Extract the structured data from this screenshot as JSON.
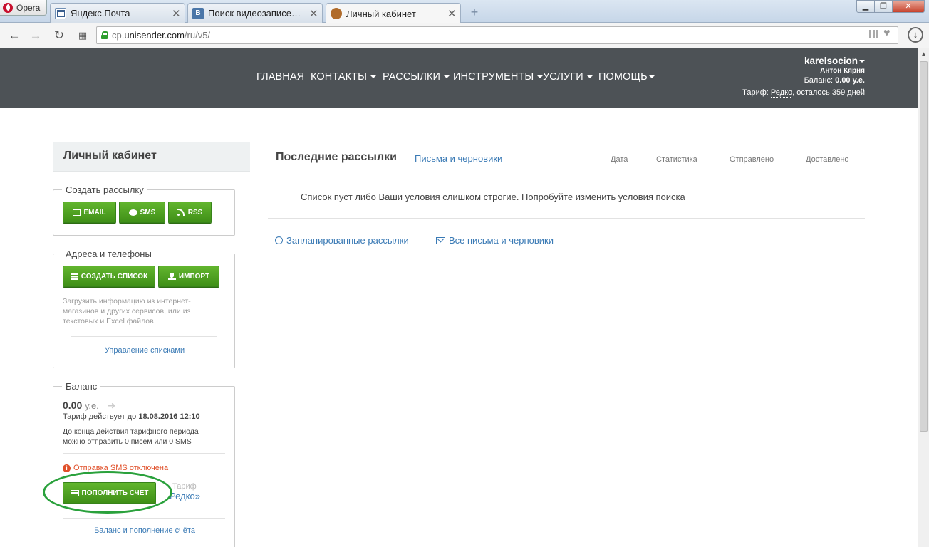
{
  "browser": {
    "opera_label": "Opera",
    "tabs": [
      {
        "title": "Яндекс.Почта",
        "active": false
      },
      {
        "title": "Поиск видеозаписей по sk",
        "active": false
      },
      {
        "title": "Личный кабинет",
        "active": true
      }
    ],
    "address": {
      "domain_prefix": "cp.",
      "domain": "unisender.com",
      "path": "/ru/v5/"
    }
  },
  "header": {
    "menu": [
      {
        "label": "Главная",
        "dropdown": false
      },
      {
        "label": "Контакты",
        "dropdown": true
      },
      {
        "label": "Рассылки",
        "dropdown": true
      },
      {
        "label": "Инструменты",
        "dropdown": true
      },
      {
        "label": "Услуги",
        "dropdown": true
      },
      {
        "label": "Помощь",
        "dropdown": true
      }
    ],
    "user": {
      "login": "karelsocion",
      "name": "Антон Кярня",
      "balance_label": "Баланс:",
      "balance_value": "0.00 у.е.",
      "tariff_label": "Тариф:",
      "tariff_value": "Редко",
      "tariff_suffix": ", осталось 359 дней"
    }
  },
  "sidebar": {
    "title": "Личный кабинет",
    "create": {
      "legend": "Создать рассылку",
      "buttons": [
        "EMAIL",
        "SMS",
        "RSS"
      ]
    },
    "contacts": {
      "legend": "Адреса и телефоны",
      "create_list": "Создать список",
      "import": "Импорт",
      "hint": "Загрузить информацию из интернет-магазинов и других сервисов, или из текстовых и Excel файлов",
      "manage_link": "Управление списками"
    },
    "balance": {
      "legend": "Баланс",
      "amount": "0.00",
      "unit": "у.е.",
      "tariff_until_label": "Тариф действует до",
      "tariff_until": "18.08.2016 12:10",
      "period_text": "До конца действия тарифного периода можно отправить 0 писем или 0 SMS",
      "sms_warning": "Отправка SMS отключена",
      "topup_button": "Пополнить счет",
      "tariff_word": "Тариф",
      "tariff_name": "Редко»",
      "balance_link": "Баланс и пополнение счёта"
    }
  },
  "main": {
    "title": "Последние рассылки",
    "letters_tab": "Письма и черновики",
    "columns": [
      "Дата",
      "Статистика",
      "Отправлено",
      "Доставлено"
    ],
    "empty_message": "Список пуст либо Ваши условия слишком строгие. Попробуйте изменить условия поиска",
    "scheduled_link": "Запланированные рассылки",
    "all_link": "Все письма и черновики"
  },
  "colors": {
    "header_bg": "#4d5256",
    "button_green": "#4ea321",
    "link_blue": "#3a7ab5",
    "warning_red": "#e0502a",
    "annotation_green": "#2aa13c"
  }
}
